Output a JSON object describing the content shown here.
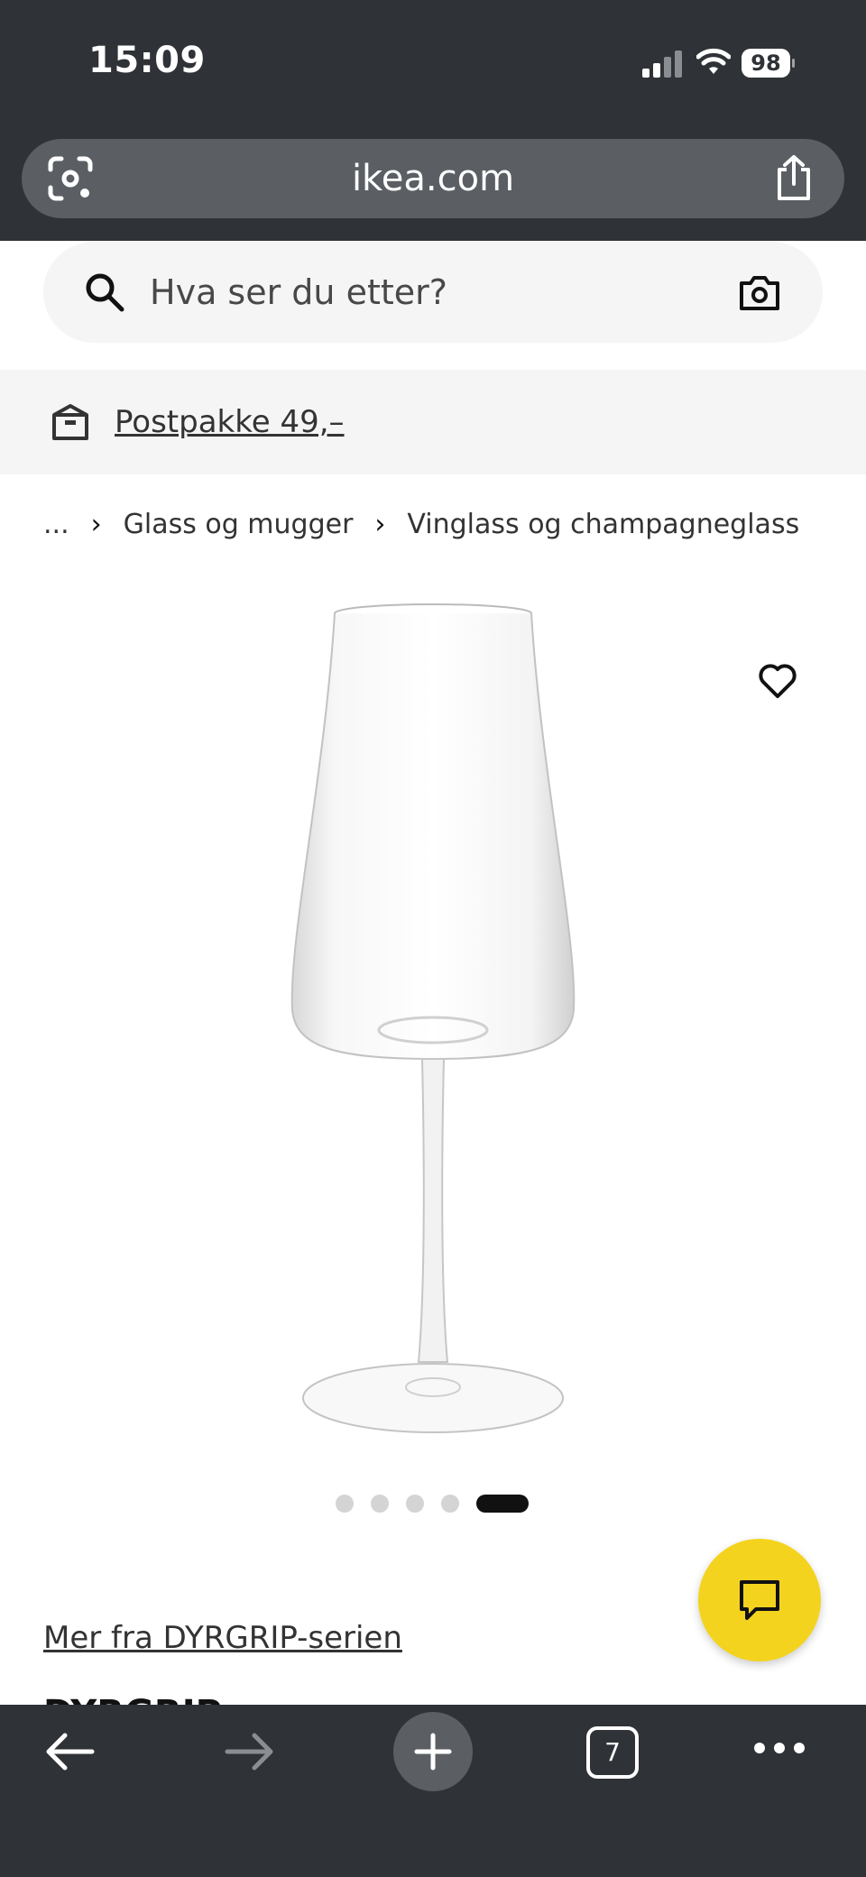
{
  "status_bar": {
    "time": "15:09",
    "battery": "98"
  },
  "browser": {
    "url": "ikea.com",
    "tab_count": "7"
  },
  "search": {
    "placeholder": "Hva ser du etter?"
  },
  "promo": {
    "label": "Postpakke 49,–"
  },
  "breadcrumb": {
    "items": [
      "...",
      "Glass og mugger",
      "Vinglass og champagneglass"
    ]
  },
  "gallery": {
    "image_count": 5,
    "active_index": 4
  },
  "product": {
    "series_link": "Mer fra DYRGRIP-serien",
    "name": "DYRGRIP"
  },
  "colors": {
    "chrome": "#2f3236",
    "chat_accent": "#f4d31e",
    "panel": "#f5f5f5"
  },
  "icons": [
    "lens-icon",
    "share-icon",
    "search-icon",
    "camera-icon",
    "box-icon",
    "heart-icon",
    "chat-icon",
    "back-icon",
    "forward-icon",
    "plus-icon",
    "more-icon"
  ]
}
